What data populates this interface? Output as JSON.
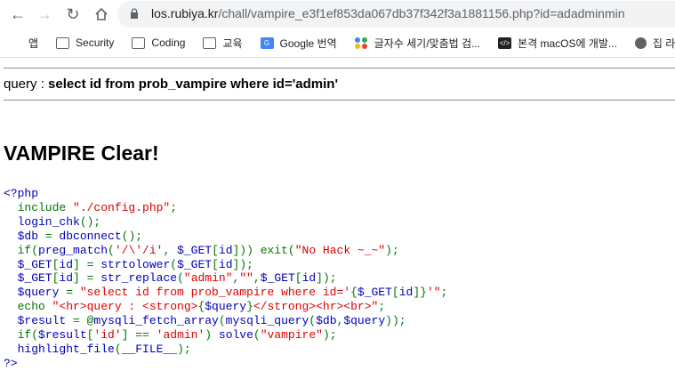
{
  "browser": {
    "url_host": "los.rubiya.kr",
    "url_path": "/chall/vampire_e3f1ef853da067db37f342f3a1881156.php?id=adadminmin",
    "bookmarks": [
      {
        "label": "앱",
        "icon": "apps-grid-icon"
      },
      {
        "label": "Security",
        "icon": "folder-icon"
      },
      {
        "label": "Coding",
        "icon": "folder-icon"
      },
      {
        "label": "교육",
        "icon": "folder-icon"
      },
      {
        "label": "Google 번역",
        "icon": "google-translate-icon"
      },
      {
        "label": "글자수 세기/맞춤법 검...",
        "icon": "dots-icon"
      },
      {
        "label": "본격 macOS에 개발...",
        "icon": "code-icon"
      },
      {
        "label": "집 라우터",
        "icon": "globe-icon"
      }
    ]
  },
  "page": {
    "query_label": "query : ",
    "query_text": "select id from prob_vampire where id='admin'",
    "clear_heading": "VAMPIRE Clear!"
  },
  "source_code": {
    "open_tag": "<?php",
    "close_tag": "?>",
    "lines": [
      [
        [
          "kw",
          "  include "
        ],
        [
          "str",
          "\"./config.php\""
        ],
        [
          "kw",
          ";"
        ]
      ],
      [
        [
          "def",
          "  login_chk"
        ],
        [
          "kw",
          "();"
        ]
      ],
      [
        [
          "def",
          "  $db "
        ],
        [
          "kw",
          "= "
        ],
        [
          "def",
          "dbconnect"
        ],
        [
          "kw",
          "();"
        ]
      ],
      [
        [
          "kw",
          "  if("
        ],
        [
          "def",
          "preg_match"
        ],
        [
          "kw",
          "("
        ],
        [
          "str",
          "'/\\'/i'"
        ],
        [
          "kw",
          ", "
        ],
        [
          "def",
          "$_GET"
        ],
        [
          "kw",
          "["
        ],
        [
          "def",
          "id"
        ],
        [
          "kw",
          "])) exit("
        ],
        [
          "str",
          "\"No Hack ~_~\""
        ],
        [
          "kw",
          ");"
        ]
      ],
      [
        [
          "def",
          "  $_GET"
        ],
        [
          "kw",
          "["
        ],
        [
          "def",
          "id"
        ],
        [
          "kw",
          "] = "
        ],
        [
          "def",
          "strtolower"
        ],
        [
          "kw",
          "("
        ],
        [
          "def",
          "$_GET"
        ],
        [
          "kw",
          "["
        ],
        [
          "def",
          "id"
        ],
        [
          "kw",
          "]);"
        ]
      ],
      [
        [
          "def",
          "  $_GET"
        ],
        [
          "kw",
          "["
        ],
        [
          "def",
          "id"
        ],
        [
          "kw",
          "] = "
        ],
        [
          "def",
          "str_replace"
        ],
        [
          "kw",
          "("
        ],
        [
          "str",
          "\"admin\""
        ],
        [
          "kw",
          ","
        ],
        [
          "str",
          "\"\""
        ],
        [
          "kw",
          ","
        ],
        [
          "def",
          "$_GET"
        ],
        [
          "kw",
          "["
        ],
        [
          "def",
          "id"
        ],
        [
          "kw",
          "]);"
        ]
      ],
      [
        [
          "def",
          "  $query "
        ],
        [
          "kw",
          "= "
        ],
        [
          "str",
          "\"select id from prob_vampire where id='"
        ],
        [
          "kw",
          "{"
        ],
        [
          "def",
          "$_GET"
        ],
        [
          "kw",
          "["
        ],
        [
          "def",
          "id"
        ],
        [
          "kw",
          "]}"
        ],
        [
          "str",
          "'\""
        ],
        [
          "kw",
          ";"
        ]
      ],
      [
        [
          "kw",
          "  echo "
        ],
        [
          "str",
          "\"<hr>query : <strong>"
        ],
        [
          "kw",
          "{"
        ],
        [
          "def",
          "$query"
        ],
        [
          "kw",
          "}"
        ],
        [
          "str",
          "</strong><hr><br>\""
        ],
        [
          "kw",
          ";"
        ]
      ],
      [
        [
          "def",
          "  $result "
        ],
        [
          "kw",
          "= @"
        ],
        [
          "def",
          "mysqli_fetch_array"
        ],
        [
          "kw",
          "("
        ],
        [
          "def",
          "mysqli_query"
        ],
        [
          "kw",
          "("
        ],
        [
          "def",
          "$db"
        ],
        [
          "kw",
          ","
        ],
        [
          "def",
          "$query"
        ],
        [
          "kw",
          "));"
        ]
      ],
      [
        [
          "kw",
          "  if("
        ],
        [
          "def",
          "$result"
        ],
        [
          "kw",
          "["
        ],
        [
          "str",
          "'id'"
        ],
        [
          "kw",
          "] == "
        ],
        [
          "str",
          "'admin'"
        ],
        [
          "kw",
          ") "
        ],
        [
          "def",
          "solve"
        ],
        [
          "kw",
          "("
        ],
        [
          "str",
          "\"vampire\""
        ],
        [
          "kw",
          ");"
        ]
      ],
      [
        [
          "def",
          "  highlight_file"
        ],
        [
          "kw",
          "("
        ],
        [
          "def",
          "__FILE__"
        ],
        [
          "kw",
          ");"
        ]
      ]
    ]
  }
}
